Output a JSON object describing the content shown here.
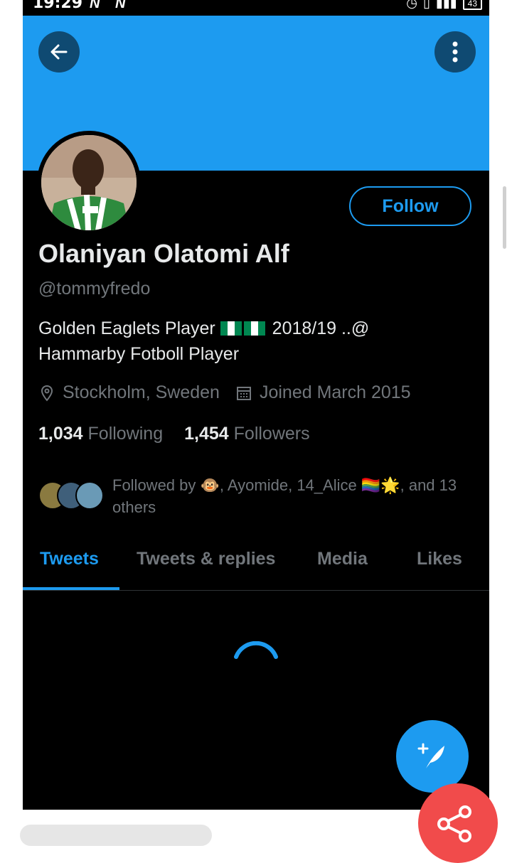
{
  "status_bar": {
    "time": "19:29",
    "n1": "N",
    "n2": "N",
    "battery": "43"
  },
  "profile": {
    "name": "Olaniyan Olatomi Alf",
    "handle": "@tommyfredo",
    "bio_line1_a": "Golden Eaglets Player",
    "bio_line1_b": "2018/19 ..@",
    "bio_line2": "Hammarby Fotboll Player",
    "location": "Stockholm, Sweden",
    "joined": "Joined March 2015",
    "following_count": "1,034",
    "following_label": "Following",
    "followers_count": "1,454",
    "followers_label": "Followers",
    "followed_by_a": "Followed by 🐵, Ayomide, 14_Alice 🏳️‍🌈🌟, and 13",
    "followed_by_b": "others"
  },
  "actions": {
    "follow_label": "Follow"
  },
  "tabs": [
    {
      "label": "Tweets"
    },
    {
      "label": "Tweets & replies"
    },
    {
      "label": "Media"
    },
    {
      "label": "Likes"
    }
  ],
  "colors": {
    "accent": "#1d9bf0",
    "banner": "#1d9bf0",
    "background": "#000000",
    "share": "#f14b4b"
  },
  "icons": [
    "back-arrow-icon",
    "more-vertical-icon",
    "location-pin-icon",
    "calendar-icon",
    "compose-tweet-icon",
    "share-icon",
    "loading-spinner-icon"
  ]
}
